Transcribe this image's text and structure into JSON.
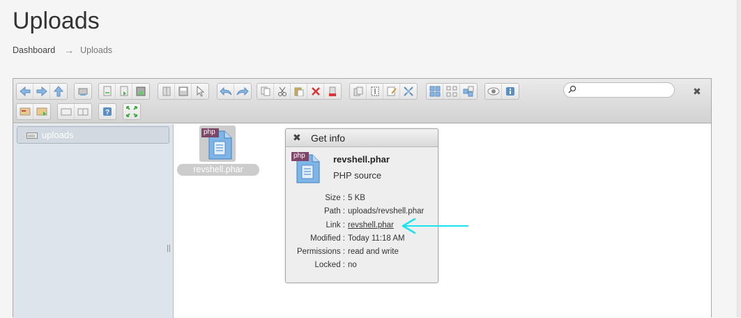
{
  "page": {
    "title": "Uploads",
    "breadcrumb": {
      "home": "Dashboard",
      "separator": "→",
      "current": "Uploads"
    }
  },
  "toolbar": {
    "groups": [
      [
        "back-icon",
        "forward-icon",
        "up-icon",
        "home-icon"
      ],
      [
        "reload-icon",
        "open-icon",
        "save-icon"
      ],
      [
        "split-icon",
        "save-doc-icon",
        "select-icon"
      ],
      [
        "undo-icon",
        "redo-icon"
      ],
      [
        "copy-icon",
        "cut-icon",
        "paste-icon",
        "delete-icon",
        "trash-icon"
      ],
      [
        "duplicate-icon",
        "rename-icon",
        "edit-icon",
        "resize-icon"
      ],
      [
        "view-icons-icon",
        "view-grid-icon",
        "view-list-icon"
      ],
      [
        "preview-icon",
        "info-icon"
      ],
      [
        "extract-icon",
        "archive-icon"
      ],
      [
        "newfolder-icon",
        "newfile-icon"
      ],
      [
        "help-icon"
      ],
      [
        "fullscreen-icon"
      ]
    ],
    "search_placeholder": "",
    "search_clear": "✖"
  },
  "tree": {
    "items": [
      {
        "label": "uploads",
        "icon": "drive-icon"
      }
    ]
  },
  "resizer_glyph": "||",
  "files": [
    {
      "name": "revshell.phar",
      "badge": "php",
      "icon": "php-file-icon"
    }
  ],
  "info_dialog": {
    "close": "✖",
    "title": "Get info",
    "badge": "php",
    "filename": "revshell.phar",
    "kind": "PHP source",
    "rows": [
      {
        "key": "Size :",
        "value": "5 KB"
      },
      {
        "key": "Path :",
        "value": "uploads/revshell.phar"
      },
      {
        "key": "Link :",
        "value": "revshell.phar"
      },
      {
        "key": "Modified :",
        "value": "Today 11:18 AM"
      },
      {
        "key": "Permissions :",
        "value": "read and write"
      },
      {
        "key": "Locked :",
        "value": "no"
      }
    ]
  },
  "colors": {
    "annotation_arrow": "#19e4ee",
    "php_badge": "#7d4667",
    "icon_blue": "#6aaae0"
  }
}
